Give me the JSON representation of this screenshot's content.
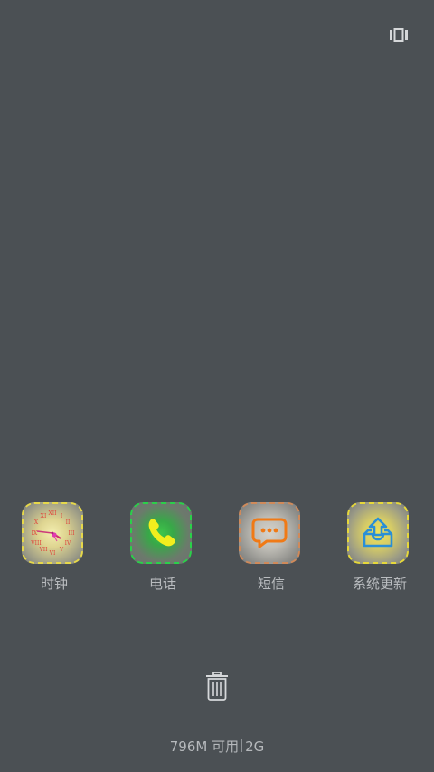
{
  "top_bar": {
    "icon": "task-switcher-icon"
  },
  "apps": [
    {
      "label": "时钟",
      "icon": "clock-icon",
      "border_color": "#e6d84a"
    },
    {
      "label": "电话",
      "icon": "phone-icon",
      "border_color": "#2bd04a"
    },
    {
      "label": "短信",
      "icon": "message-icon",
      "border_color": "#d08a5a"
    },
    {
      "label": "系统更新",
      "icon": "system-update-icon",
      "border_color": "#e6d83a"
    }
  ],
  "trash": {
    "icon": "trash-icon"
  },
  "memory": {
    "available": "796M 可用",
    "total": "2G"
  },
  "colors": {
    "background": "#4b5054",
    "label": "#b9bcbf"
  }
}
